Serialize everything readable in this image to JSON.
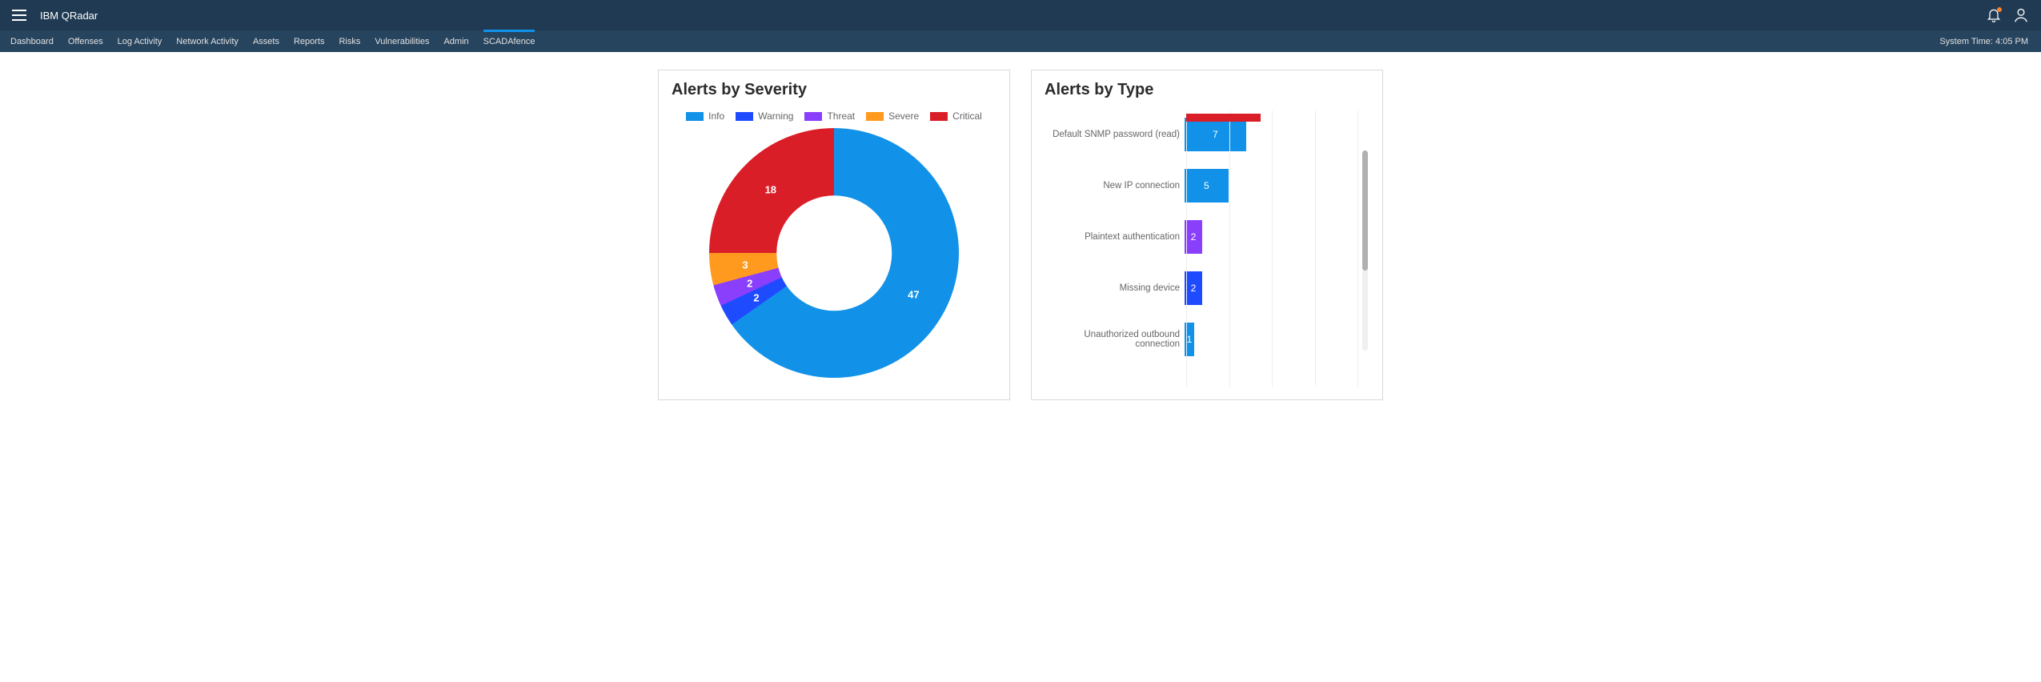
{
  "header": {
    "app_title": "IBM QRadar"
  },
  "nav": {
    "items": [
      "Dashboard",
      "Offenses",
      "Log Activity",
      "Network Activity",
      "Assets",
      "Reports",
      "Risks",
      "Vulnerabilities",
      "Admin",
      "SCADAfence"
    ],
    "active_index": 9,
    "system_time_label": "System Time: 4:05 PM"
  },
  "cards": {
    "severity": {
      "title": "Alerts by Severity",
      "legend": [
        "Info",
        "Warning",
        "Threat",
        "Severe",
        "Critical"
      ]
    },
    "type": {
      "title": "Alerts by Type"
    }
  },
  "chart_data": [
    {
      "type": "pie",
      "title": "Alerts by Severity",
      "series": [
        {
          "name": "Info",
          "value": 47,
          "color": "#1192e8"
        },
        {
          "name": "Warning",
          "value": 2,
          "color": "#1f4bff"
        },
        {
          "name": "Threat",
          "value": 2,
          "color": "#8a3ffc"
        },
        {
          "name": "Severe",
          "value": 3,
          "color": "#ff9a1f"
        },
        {
          "name": "Critical",
          "value": 18,
          "color": "#da1e28"
        }
      ],
      "donut": true
    },
    {
      "type": "bar",
      "orientation": "horizontal",
      "title": "Alerts by Type",
      "categories": [
        "Default SNMP password (read)",
        "New IP connection",
        "Plaintext authentication",
        "Missing device",
        "Unauthorized outbound connection"
      ],
      "values": [
        7,
        5,
        2,
        2,
        1
      ],
      "colors": [
        "#1192e8",
        "#1192e8",
        "#8a3ffc",
        "#1f4bff",
        "#1192e8"
      ],
      "xlim": [
        0,
        20
      ]
    }
  ]
}
